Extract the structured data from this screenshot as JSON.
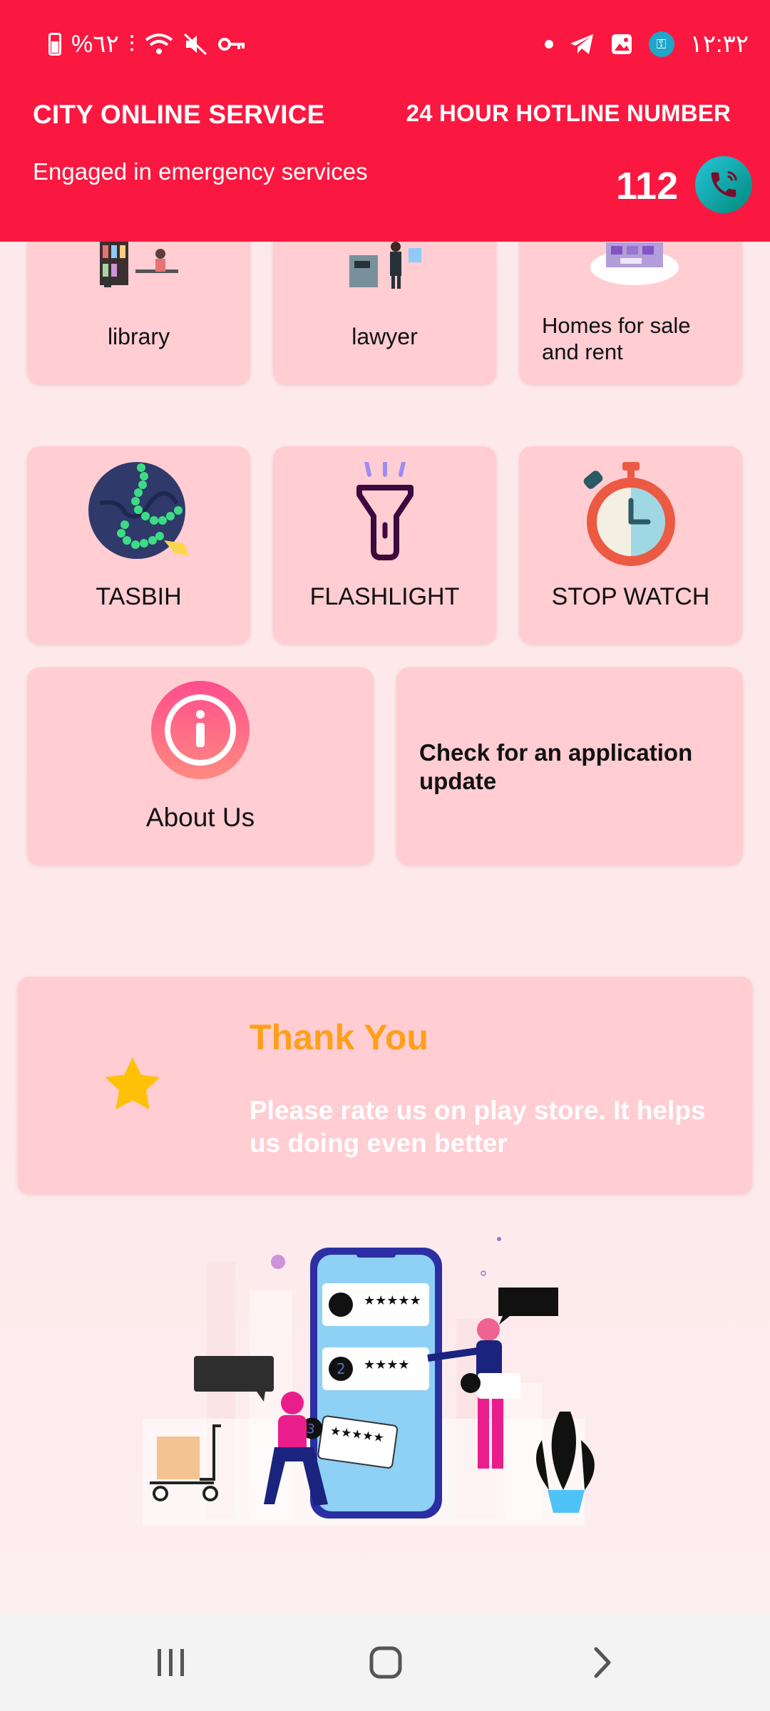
{
  "status_bar": {
    "battery": "%٦٢",
    "time": "١٢:٣٢"
  },
  "header": {
    "title": "CITY ONLINE SERVICE",
    "subtitle": "Engaged in emergency services",
    "hotline_title": "24 HOUR HOTLINE NUMBER",
    "hotline_number": "112"
  },
  "services": {
    "library": "library",
    "lawyer": "lawyer",
    "homes": [
      "Homes for sale",
      "and rent"
    ],
    "tasbih": "TASBIH",
    "flashlight": "FLASHLIGHT",
    "stopwatch": "STOP WATCH",
    "about": "About Us",
    "update": [
      "Check for an application",
      "update"
    ]
  },
  "rate": {
    "title": "Thank You",
    "text": "Please rate us on play store. It helps us doing even better"
  },
  "colors": {
    "header": "#fa1840",
    "card": "#ffcdd2",
    "thank_title": "#ff9f1a"
  }
}
